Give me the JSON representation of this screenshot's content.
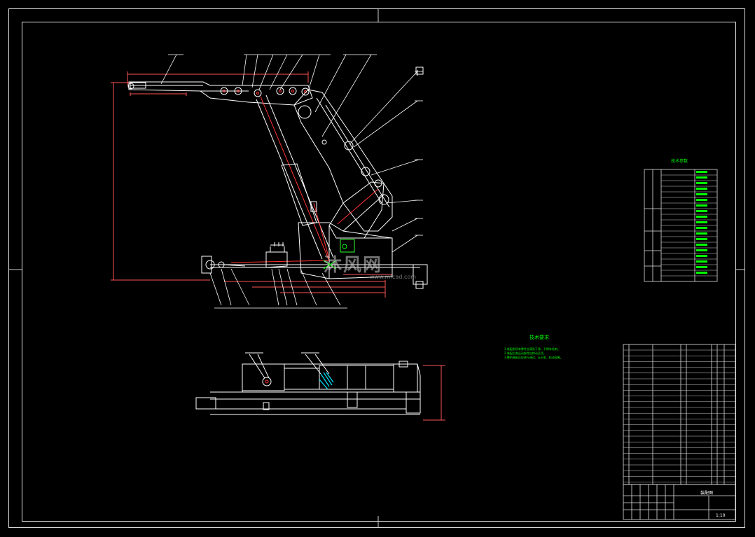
{
  "drawing": {
    "watermark_text": "沐风网",
    "watermark_url": "www.mfcad.com",
    "color_line": "#ffffff",
    "color_accent": "#00ff00",
    "color_part_highlight": "#ff3333",
    "color_dimension": "#ff4444"
  },
  "tech_requirements": {
    "title": "技术要求",
    "lines": [
      "1.装配前所有零件应清洗干净，不得有毛刺。",
      "2.装配后各运动部件应转动灵活。",
      "3.整机装配后应进行调试，无卡阻、松动现象。"
    ]
  },
  "spec_table": {
    "title": "技术参数"
  },
  "title_block": {
    "title": "装配图",
    "scale": "1:10"
  }
}
